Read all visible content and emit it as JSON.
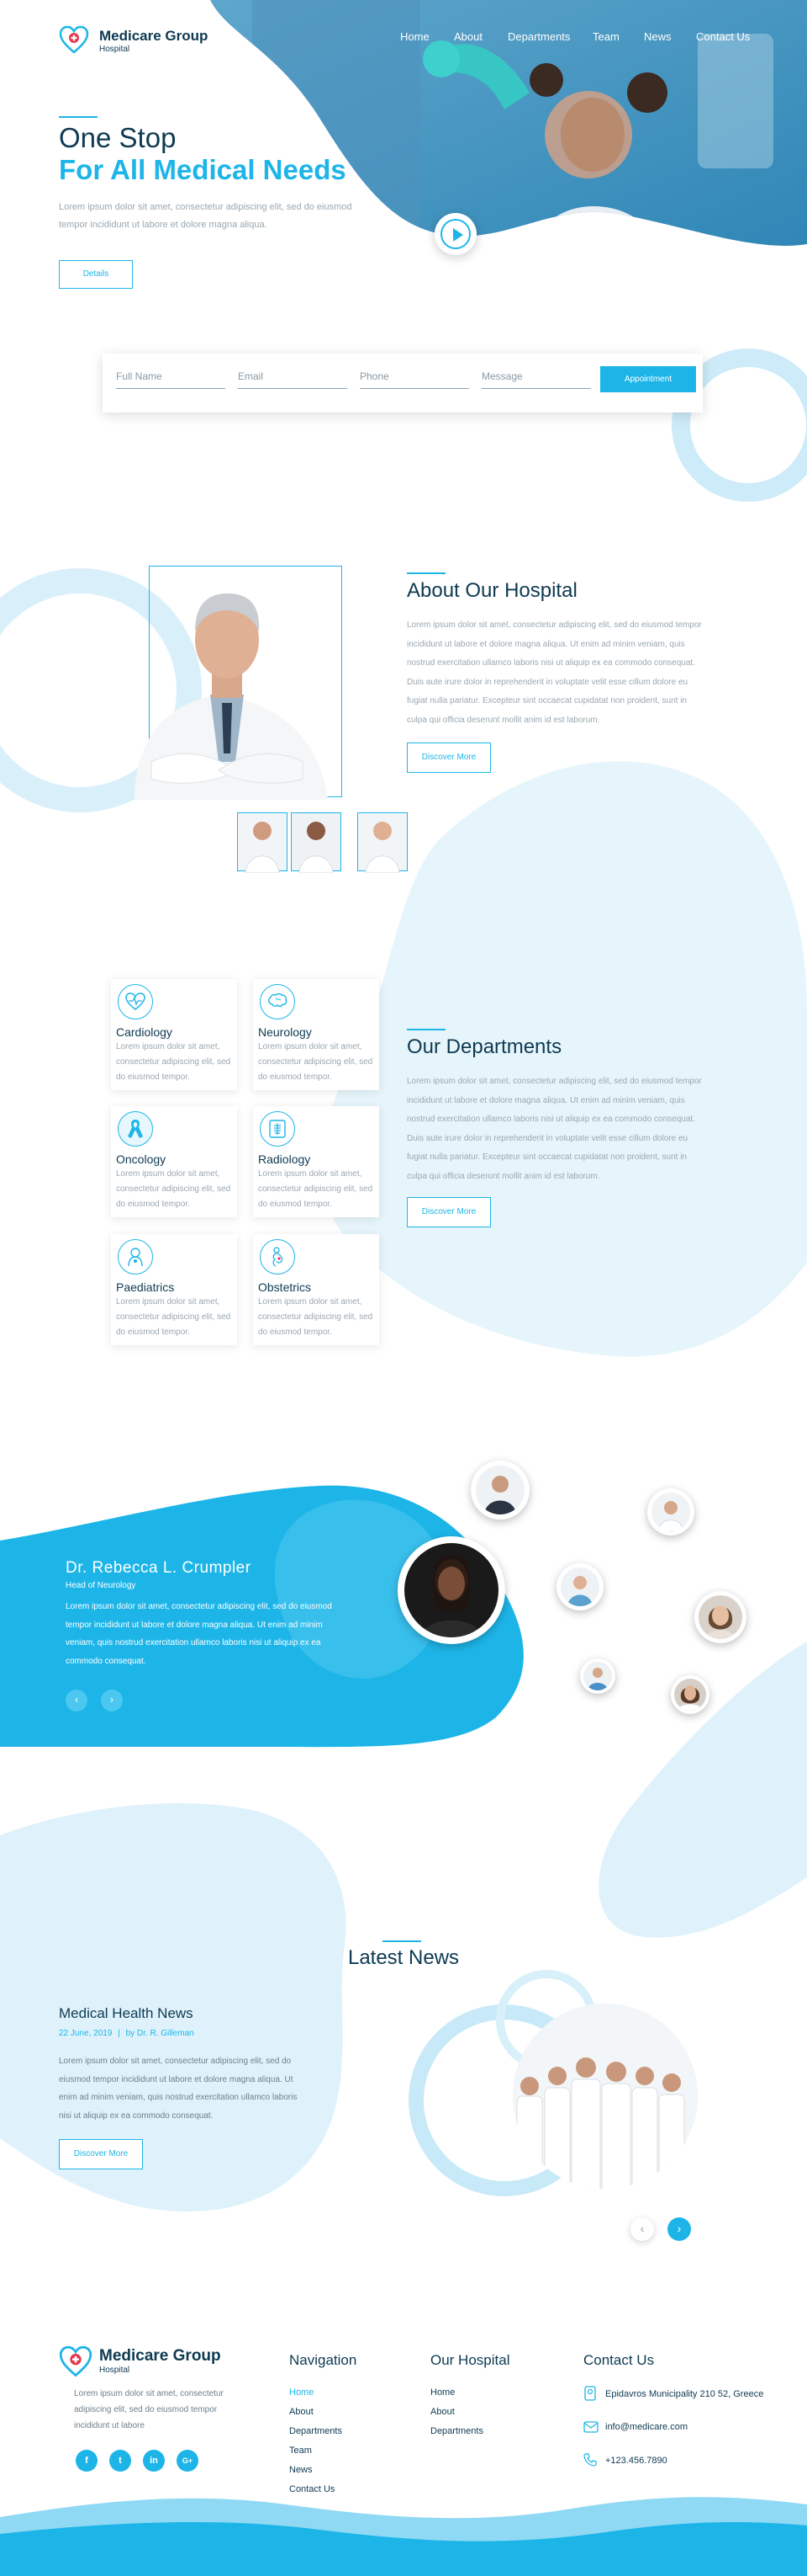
{
  "brand": {
    "name": "Medicare Group",
    "sub": "Hospital"
  },
  "nav": [
    "Home",
    "About",
    "Departments",
    "Team",
    "News",
    "Contact Us"
  ],
  "hero": {
    "title1": "One Stop",
    "title2": "For All Medical Needs",
    "text": "Lorem ipsum dolor sit amet, consectetur adipiscing elit, sed do eiusmod tempor incididunt ut labore et dolore magna aliqua.",
    "button": "Details"
  },
  "form": {
    "name": "Full Name",
    "email": "Email",
    "phone": "Phone",
    "message": "Message",
    "button": "Appointment"
  },
  "about": {
    "title": "About Our Hospital",
    "text": "Lorem ipsum dolor sit amet, consectetur adipiscing elit, sed do eiusmod tempor incididunt ut labore et dolore magna aliqua. Ut enim ad minim veniam, quis nostrud exercitation ullamco laboris nisi ut aliquip ex ea commodo consequat. Duis aute irure dolor in reprehenderit in voluptate velit esse cillum dolore eu fugiat nulla pariatur. Excepteur sint occaecat cupidatat non proident, sunt in culpa qui officia deserunt mollit anim id est laborum.",
    "button": "Discover More"
  },
  "departments": {
    "title": "Our Departments",
    "text": "Lorem ipsum dolor sit amet, consectetur adipiscing elit, sed do eiusmod tempor incididunt ut labore et dolore magna aliqua. Ut enim ad minim veniam, quis nostrud exercitation ullamco laboris nisi ut aliquip ex ea commodo consequat. Duis aute irure dolor in reprehenderit in voluptate velit esse cillum dolore eu fugiat nulla pariatur. Excepteur sint occaecat cupidatat non proident, sunt in culpa qui officia deserunt mollit anim id est laborum.",
    "button": "Discover More",
    "cards": [
      {
        "title": "Cardiology",
        "text": "Lorem ipsum dolor sit amet, consectetur adipiscing elit, sed do eiusmod tempor.",
        "icon": "heart-pulse-icon"
      },
      {
        "title": "Neurology",
        "text": "Lorem ipsum dolor sit amet, consectetur adipiscing elit, sed do eiusmod tempor.",
        "icon": "brain-icon"
      },
      {
        "title": "Oncology",
        "text": "Lorem ipsum dolor sit amet, consectetur adipiscing elit, sed do eiusmod tempor.",
        "icon": "ribbon-icon"
      },
      {
        "title": "Radiology",
        "text": "Lorem ipsum dolor sit amet, consectetur adipiscing elit, sed do eiusmod tempor.",
        "icon": "xray-icon"
      },
      {
        "title": "Paediatrics",
        "text": "Lorem ipsum dolor sit amet, consectetur adipiscing elit, sed do eiusmod tempor.",
        "icon": "baby-icon"
      },
      {
        "title": "Obstetrics",
        "text": "Lorem ipsum dolor sit amet, consectetur adipiscing elit, sed do eiusmod tempor.",
        "icon": "pregnancy-icon"
      }
    ]
  },
  "doctor": {
    "name": "Dr. Rebecca L. Crumpler",
    "role": "Head of Neurology",
    "text": "Lorem ipsum dolor sit amet, consectetur adipiscing elit, sed do eiusmod tempor incididunt ut labore et dolore magna aliqua. Ut enim ad minim veniam, quis nostrud exercitation ullamco laboris nisi ut aliquip ex ea commodo consequat."
  },
  "news": {
    "section": "Latest News",
    "title": "Medical Health News",
    "date": "22 June, 2019",
    "sep": "|",
    "by": "by",
    "author": "Dr. R. Gilleman",
    "text": "Lorem ipsum dolor sit amet, consectetur adipiscing elit, sed do eiusmod tempor incididunt ut labore et dolore magna aliqua. Ut enim ad minim veniam, quis nostrud exercitation ullamco laboris nisi ut aliquip ex ea commodo consequat.",
    "button": "Discover More"
  },
  "footer": {
    "text": "Lorem ipsum dolor sit amet, consectetur adipiscing elit, sed do eiusmod tempor incididunt ut labore",
    "social": [
      "f",
      "t",
      "in",
      "G+"
    ],
    "nav_title": "Navigation",
    "nav": [
      "Home",
      "About",
      "Departments",
      "Team",
      "News",
      "Contact Us"
    ],
    "hosp_title": "Our Hospital",
    "hosp": [
      "Home",
      "About",
      "Departments"
    ],
    "contact_title": "Contact Us",
    "address": "Epidavros Municipality 210 52, Greece",
    "email": "info@medicare.com",
    "phone": "+123.456.7890"
  },
  "colors": {
    "accent": "#1db5e8",
    "dark": "#0e3a52",
    "light": "#e3f4fb"
  }
}
